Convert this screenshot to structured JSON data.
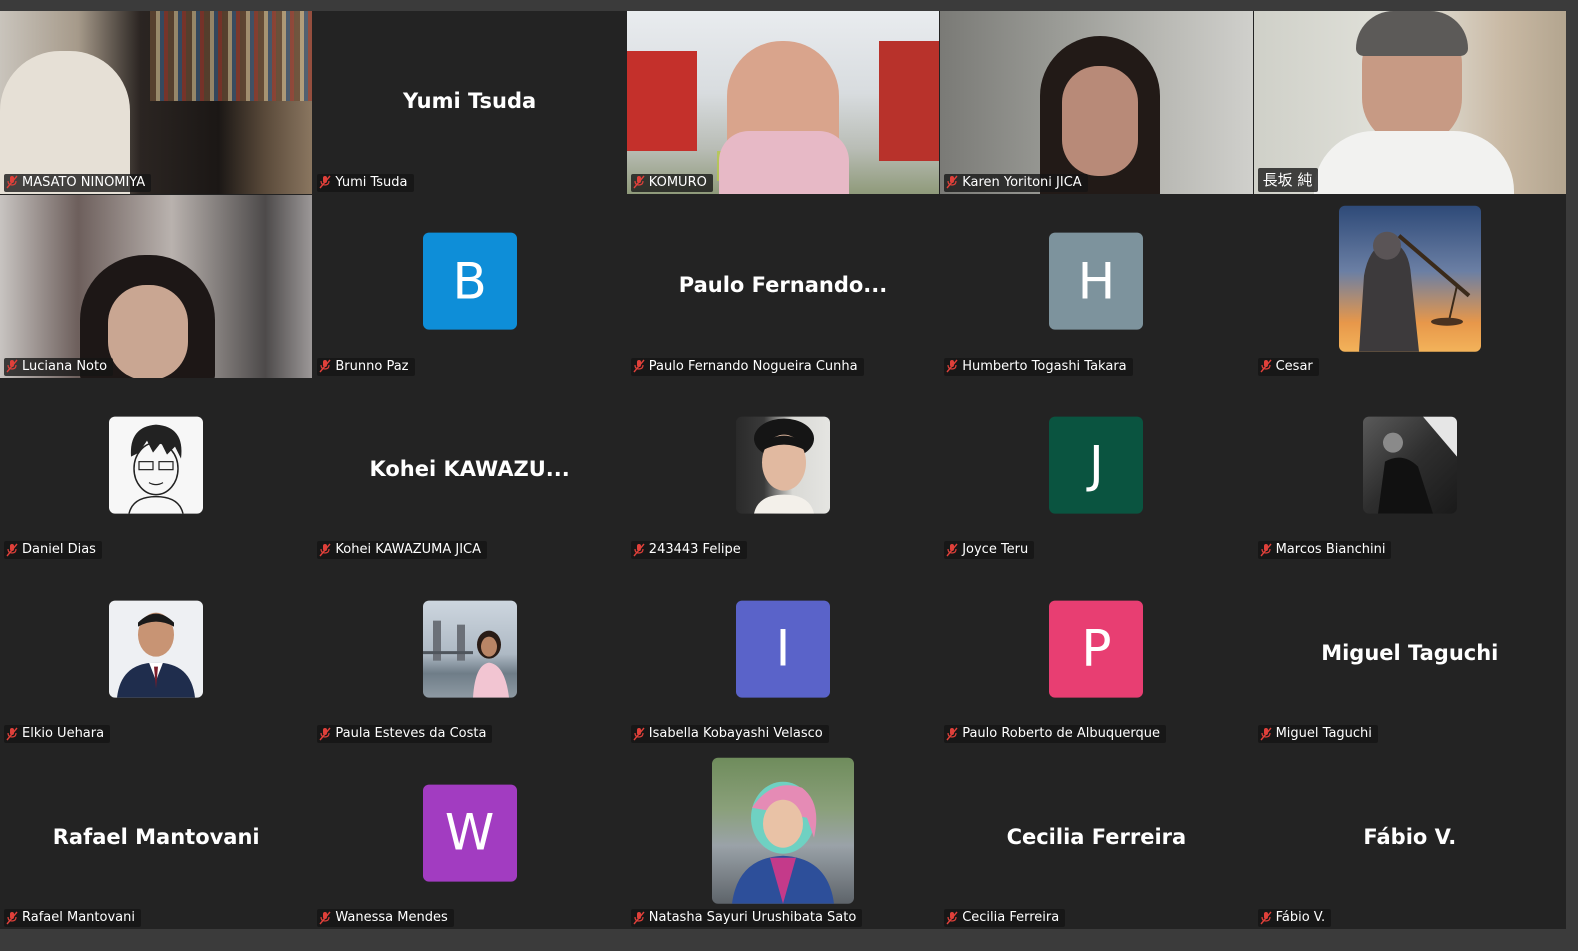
{
  "colors": {
    "tile_bg": "#232323",
    "active_border": "#23d964",
    "mute_red": "#e0403a"
  },
  "participants": [
    {
      "display": "video",
      "label": "MASATO NINOMIYA",
      "muted": true
    },
    {
      "display": "name",
      "big_name": "Yumi Tsuda",
      "label": "Yumi Tsuda",
      "muted": true
    },
    {
      "display": "video",
      "label": "KOMURO",
      "muted": true
    },
    {
      "display": "video",
      "label": "Karen Yoritoni JICA",
      "muted": true
    },
    {
      "display": "video",
      "label": "長坂 純",
      "muted": false,
      "active": true
    },
    {
      "display": "video",
      "label": "Luciana Noto",
      "muted": true
    },
    {
      "display": "letter",
      "letter": "B",
      "color": "#0e8ed8",
      "label": "Brunno Paz",
      "muted": true
    },
    {
      "display": "name",
      "big_name": "Paulo  Fernando...",
      "label": "Paulo Fernando Nogueira Cunha",
      "muted": true
    },
    {
      "display": "letter",
      "letter": "H",
      "color": "#7d939d",
      "label": "Humberto Togashi Takara",
      "muted": true
    },
    {
      "display": "photo",
      "photo": "justice-statue-icon",
      "label": "Cesar",
      "muted": true
    },
    {
      "display": "photo",
      "photo": "cartoon-avatar-icon",
      "label": "Daniel Dias",
      "muted": true
    },
    {
      "display": "name",
      "big_name": "Kohei  KAWAZU...",
      "label": "Kohei KAWAZUMA JICA",
      "muted": true
    },
    {
      "display": "photo",
      "photo": "profile-photo-icon",
      "label": "243443 Felipe",
      "muted": true
    },
    {
      "display": "letter",
      "letter": "J",
      "color": "#0a5440",
      "label": "Joyce Teru",
      "muted": true
    },
    {
      "display": "photo",
      "photo": "dark-figure-icon",
      "label": "Marcos Bianchini",
      "muted": true
    },
    {
      "display": "photo",
      "photo": "suit-portrait-icon",
      "label": "Elkio Uehara",
      "muted": true
    },
    {
      "display": "photo",
      "photo": "bridge-photo-icon",
      "label": "Paula Esteves da Costa",
      "muted": true
    },
    {
      "display": "letter",
      "letter": "I",
      "color": "#5a63c9",
      "label": "Isabella Kobayashi Velasco",
      "muted": true
    },
    {
      "display": "letter",
      "letter": "P",
      "color": "#e83e72",
      "label": "Paulo Roberto de Albuquerque",
      "muted": true
    },
    {
      "display": "name",
      "big_name": "Miguel Taguchi",
      "label": "Miguel Taguchi",
      "muted": true
    },
    {
      "display": "name",
      "big_name": "Rafael Mantovani",
      "label": "Rafael Mantovani",
      "muted": true
    },
    {
      "display": "letter",
      "letter": "W",
      "color": "#a23cc1",
      "label": "Wanessa Mendes",
      "muted": true
    },
    {
      "display": "photo",
      "photo": "colorful-hair-icon",
      "label": "Natasha Sayuri Urushibata Sato",
      "muted": true
    },
    {
      "display": "name",
      "big_name": "Cecilia Ferreira",
      "label": "Cecilia Ferreira",
      "muted": true
    },
    {
      "display": "name",
      "big_name": "Fábio V.",
      "label": "Fábio V.",
      "muted": true
    }
  ]
}
